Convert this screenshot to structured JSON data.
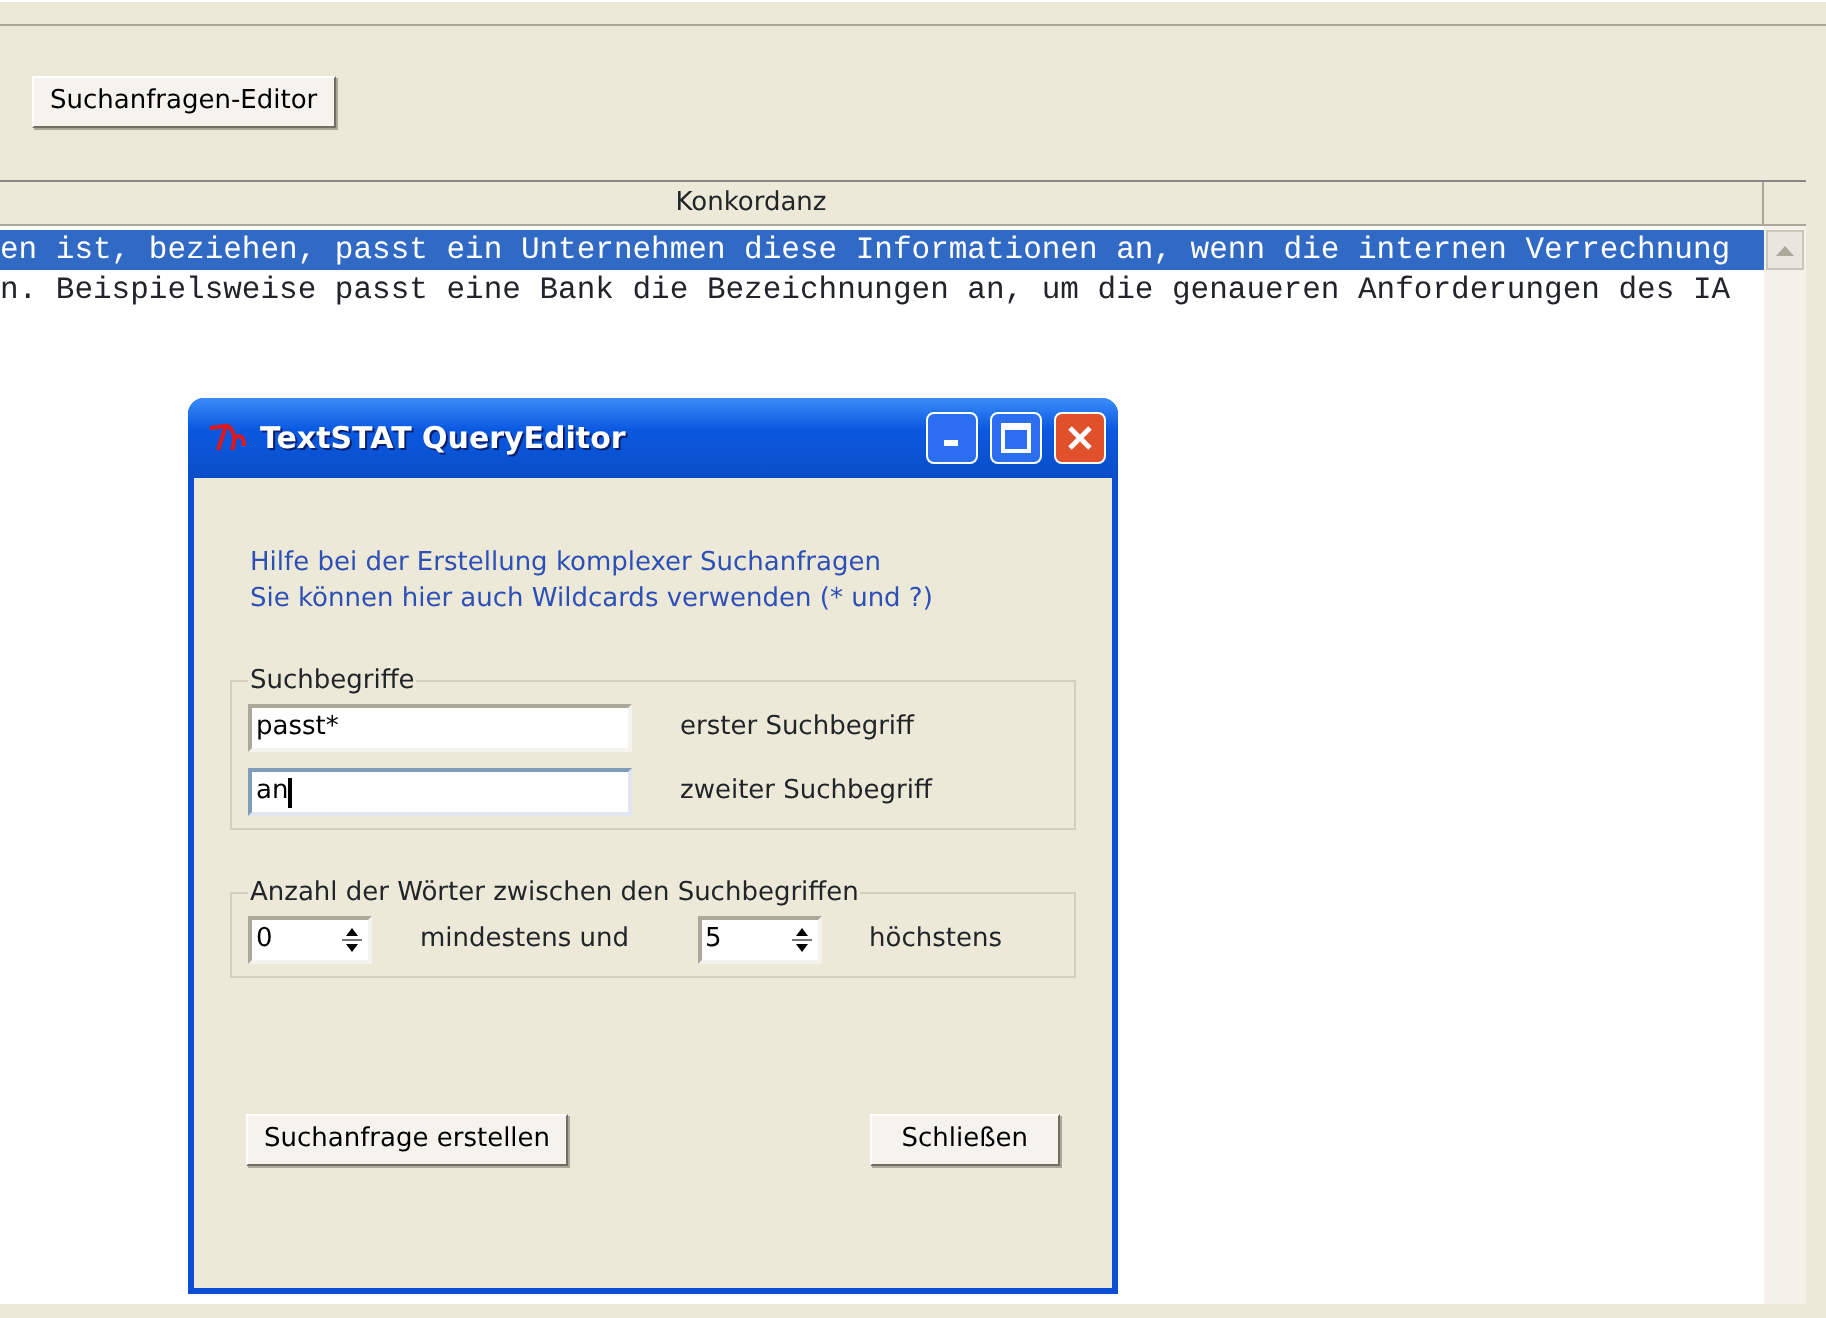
{
  "toolbar": {
    "button": "Suchanfragen-Editor"
  },
  "table": {
    "columns": [
      "Konkordanz"
    ],
    "rows": [
      {
        "text": "en ist, beziehen, passt ein Unternehmen diese Informationen an, wenn die internen Verrechnung",
        "selected": true
      },
      {
        "text": "n. Beispielsweise passt eine Bank die Bezeichnungen an, um die genaueren Anforderungen des IA",
        "selected": false
      }
    ]
  },
  "dialog": {
    "title": "TextSTAT QueryEditor",
    "help": [
      "Hilfe bei der Erstellung komplexer Suchanfragen",
      "Sie können hier auch Wildcards verwenden (* und ?)"
    ],
    "terms": {
      "legend": "Suchbegriffe",
      "fields": [
        {
          "value": "passt*",
          "label": "erster Suchbegriff",
          "focused": false
        },
        {
          "value": "an",
          "label": "zweiter Suchbegriff",
          "focused": true
        }
      ]
    },
    "distance": {
      "legend": "Anzahl der Wörter zwischen den Suchbegriffen",
      "min": "0",
      "min_label": "mindestens und",
      "max": "5",
      "max_label": "höchstens"
    },
    "buttons": [
      "Suchanfrage erstellen",
      "Schließen"
    ]
  }
}
